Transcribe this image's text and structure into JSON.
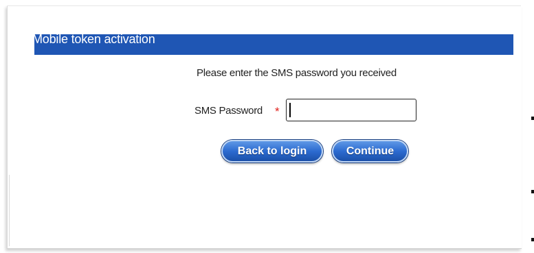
{
  "header": {
    "title": "Mobile token activation"
  },
  "form": {
    "instruction": "Please enter the SMS password you received",
    "password_label": "SMS Password",
    "required_marker": "*",
    "password_value": ""
  },
  "buttons": {
    "back_label": "Back to login",
    "continue_label": "Continue"
  },
  "colors": {
    "title_bar": "#1f56b4",
    "button": "#2c6bd0",
    "required": "#e0201b"
  }
}
